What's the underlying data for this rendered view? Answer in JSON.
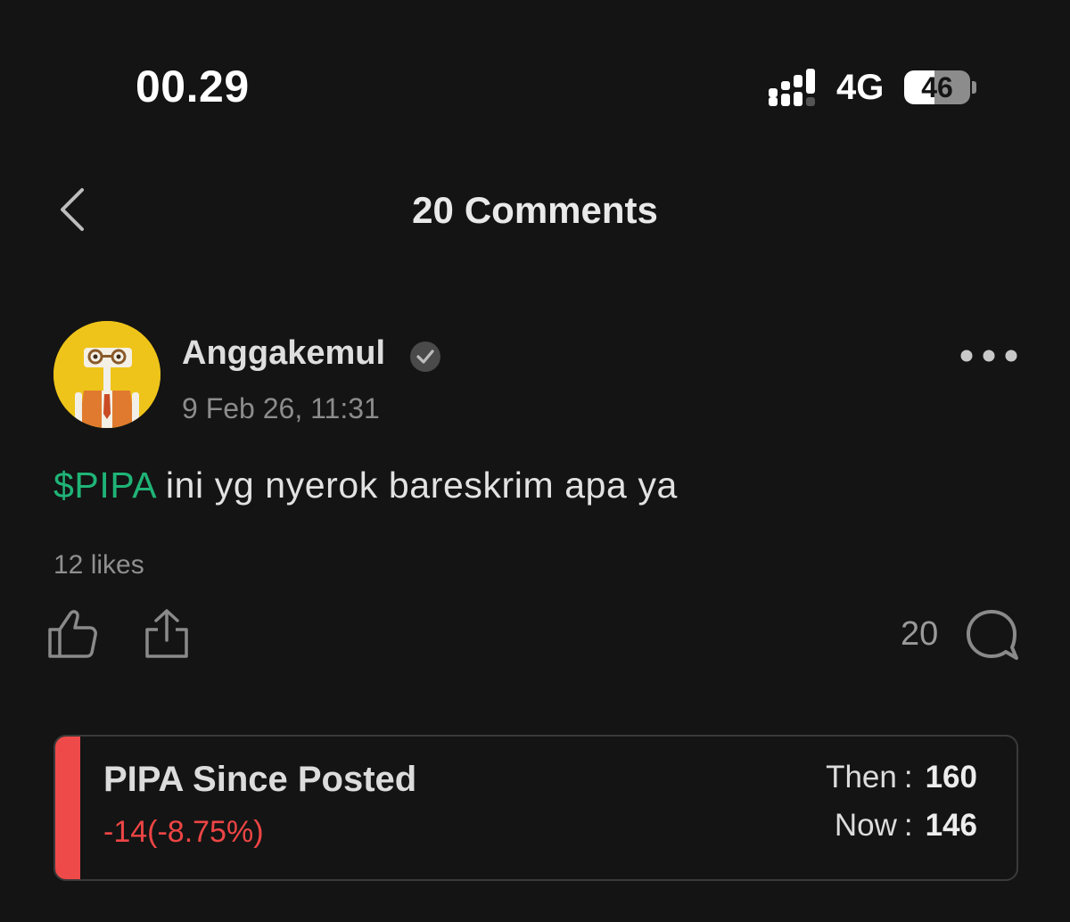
{
  "status_bar": {
    "time": "00.29",
    "network": "4G",
    "battery_level": "46",
    "signal_icon": "signal-bars-icon"
  },
  "header": {
    "count": "20",
    "label": "Comments",
    "back_icon": "chevron-left-icon"
  },
  "post": {
    "author": "Anggakemul",
    "verified_icon": "verified-check-icon",
    "date": "9 Feb 26, 11:31",
    "ticker": "$PIPA",
    "text": " ini yg nyerok bareskrim apa ya",
    "likes": "12 likes",
    "comment_count": "20",
    "icons": {
      "like": "thumbs-up-icon",
      "share": "share-icon",
      "comment": "comment-bubble-icon",
      "more": "more-dots-icon"
    }
  },
  "performance_card": {
    "title": "PIPA Since Posted",
    "change": "-14(-8.75%)",
    "then_label": "Then",
    "then_value": "160",
    "now_label": "Now",
    "now_value": "146",
    "separator": ":",
    "accent_color": "#ef4a4a"
  },
  "colors": {
    "background": "#141414",
    "ticker_green": "#1fb477",
    "negative_red": "#ee4545"
  }
}
